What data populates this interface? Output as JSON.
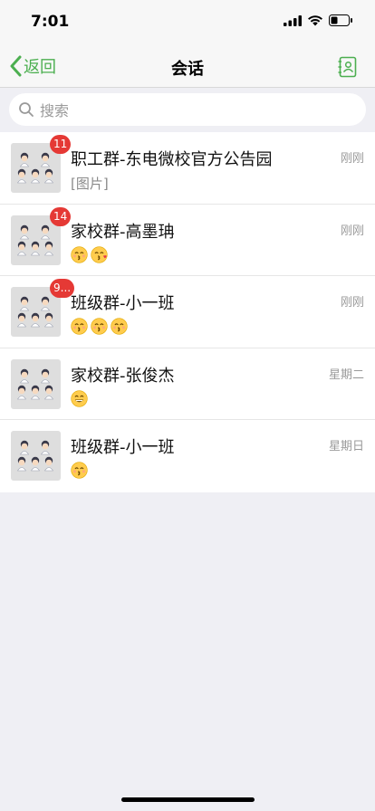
{
  "status_bar": {
    "time": "7:01"
  },
  "nav": {
    "back_label": "返回",
    "title": "会话"
  },
  "search": {
    "placeholder": "搜索"
  },
  "conversations": [
    {
      "title": "职工群-东电微校官方公告园",
      "time": "刚刚",
      "badge": "11",
      "preview_text": "[图片]",
      "emojis": []
    },
    {
      "title": "家校群-高墨珃",
      "time": "刚刚",
      "badge": "14",
      "preview_text": "",
      "emojis": [
        "kissing",
        "kiss-heart"
      ]
    },
    {
      "title": "班级群-小一班",
      "time": "刚刚",
      "badge": "9...",
      "preview_text": "",
      "emojis": [
        "kissing",
        "kissing",
        "kissing"
      ]
    },
    {
      "title": "家校群-张俊杰",
      "time": "星期二",
      "badge": "",
      "preview_text": "",
      "emojis": [
        "grin"
      ]
    },
    {
      "title": "班级群-小一班",
      "time": "星期日",
      "badge": "",
      "preview_text": "",
      "emojis": [
        "kissing"
      ]
    }
  ],
  "colors": {
    "accent": "#4caf50",
    "badge": "#e53935",
    "background": "#efeff4"
  }
}
